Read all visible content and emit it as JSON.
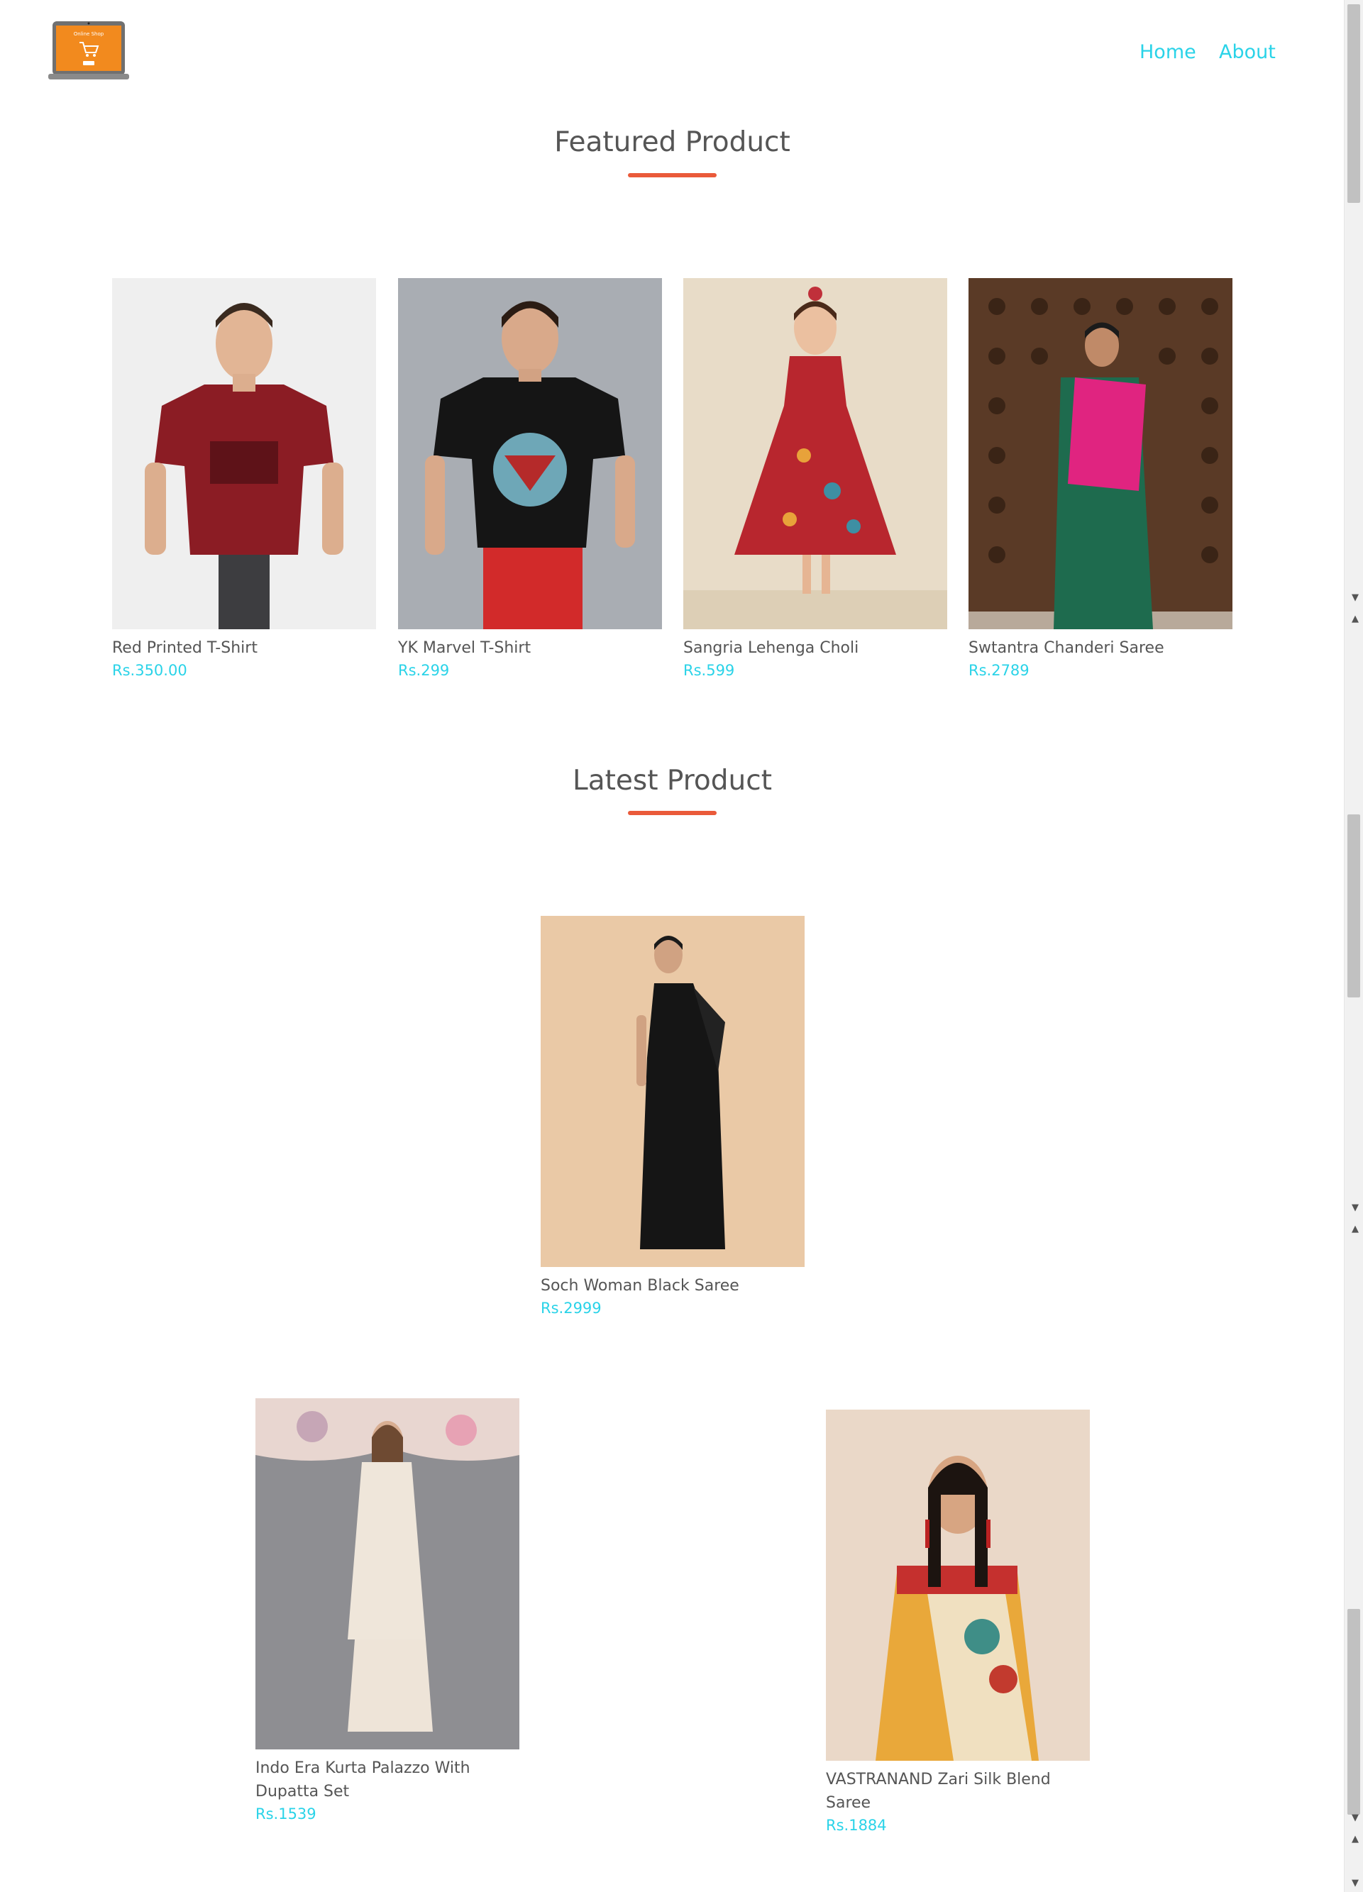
{
  "nav": {
    "home_label": "Home",
    "about_label": "About"
  },
  "logo": {
    "icon": "laptop-cart-logo",
    "text": "Online Shop"
  },
  "sections": {
    "featured": {
      "title": "Featured Product"
    },
    "latest": {
      "title": "Latest Product"
    }
  },
  "featured_products": [
    {
      "name": "Red Printed T-Shirt",
      "price": "Rs.350.00"
    },
    {
      "name": "YK Marvel T-Shirt",
      "price": "Rs.299"
    },
    {
      "name": "Sangria Lehenga Choli",
      "price": "Rs.599"
    },
    {
      "name": "Swtantra Chanderi Saree",
      "price": "Rs.2789"
    }
  ],
  "latest_products": [
    {
      "name": "Soch Woman Black Saree",
      "price": "Rs.2999"
    },
    {
      "name": "Indo Era Kurta Palazzo With Dupatta Set",
      "price": "Rs.1539"
    },
    {
      "name": "VASTRANAND Zari Silk Blend Saree",
      "price": "Rs.1884"
    }
  ],
  "colors": {
    "accent": "#2ad3e8",
    "title_underline": "#ea5a3a",
    "text": "#555555"
  }
}
